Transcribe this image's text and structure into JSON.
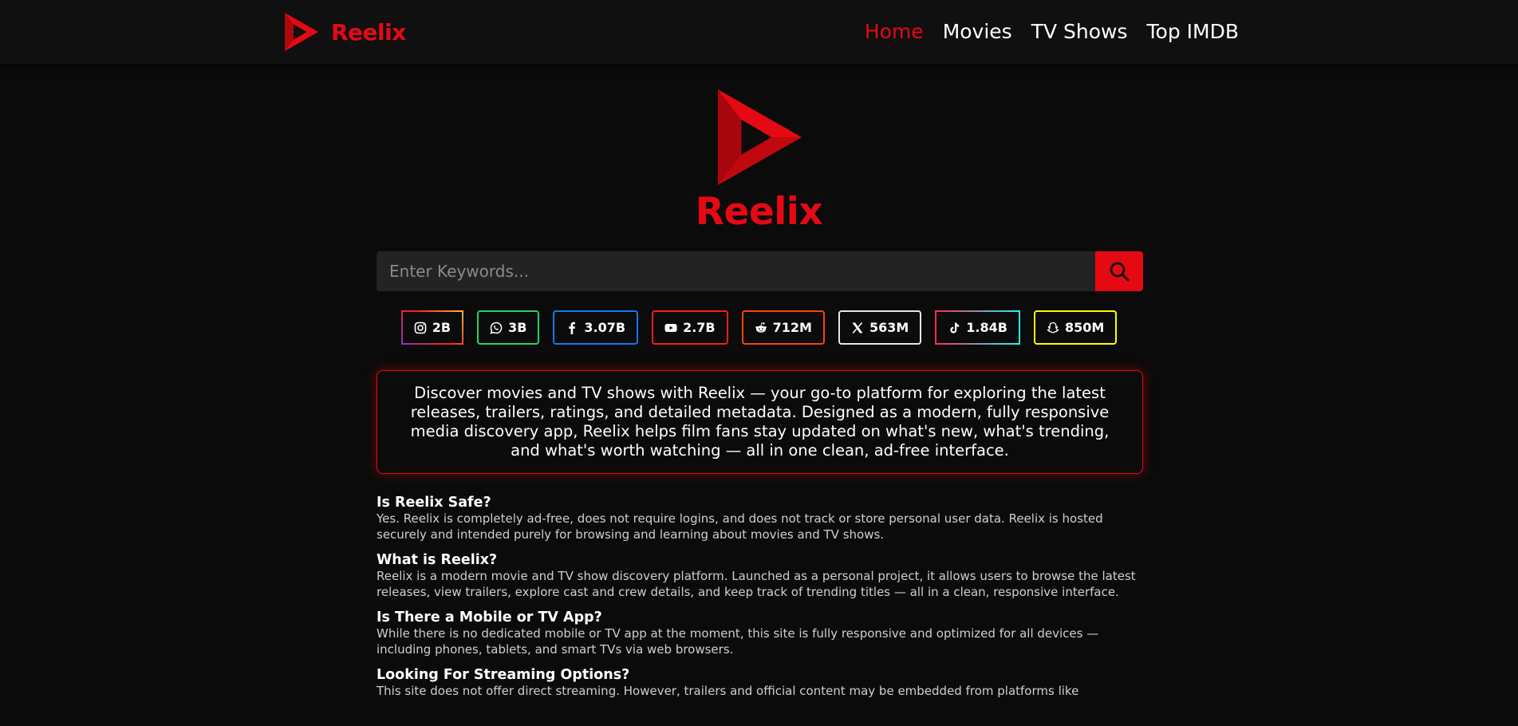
{
  "colors": {
    "accent": "#e50914",
    "background": "#0b0b0b",
    "search_bg": "#232323"
  },
  "header": {
    "brand": "Reelix",
    "logo_icon": "play-logo-icon",
    "nav": [
      {
        "label": "Home",
        "active": true
      },
      {
        "label": "Movies",
        "active": false
      },
      {
        "label": "TV Shows",
        "active": false
      },
      {
        "label": "Top IMDB",
        "active": false
      }
    ]
  },
  "hero": {
    "title": "Reelix",
    "logo_icon": "play-logo-icon"
  },
  "search": {
    "placeholder": "Enter Keywords...",
    "value": "",
    "button_icon": "search-icon"
  },
  "socials": [
    {
      "icon": "instagram-icon",
      "count": "2B",
      "color": "#c13584"
    },
    {
      "icon": "whatsapp-icon",
      "count": "3B",
      "color": "#25d366"
    },
    {
      "icon": "facebook-icon",
      "count": "3.07B",
      "color": "#1877f2"
    },
    {
      "icon": "youtube-icon",
      "count": "2.7B",
      "color": "#ff0000"
    },
    {
      "icon": "reddit-icon",
      "count": "712M",
      "color": "#ff4500"
    },
    {
      "icon": "x-icon",
      "count": "563M",
      "color": "#e6e6e6"
    },
    {
      "icon": "tiktok-icon",
      "count": "1.84B",
      "color": "#fe2c55"
    },
    {
      "icon": "snapchat-icon",
      "count": "850M",
      "color": "#fffc00"
    }
  ],
  "intro": {
    "text": "Discover movies and TV shows with Reelix — your go-to platform for exploring the latest releases, trailers, ratings, and detailed metadata. Designed as a modern, fully responsive media discovery app, Reelix helps film fans stay updated on what's new, what's trending, and what's worth watching — all in one clean, ad-free interface."
  },
  "faq": [
    {
      "question": "Is Reelix Safe?",
      "answer": "Yes. Reelix is completely ad-free, does not require logins, and does not track or store personal user data. Reelix is hosted securely and intended purely for browsing and learning about movies and TV shows."
    },
    {
      "question": "What is Reelix?",
      "answer": "Reelix is a modern movie and TV show discovery platform. Launched as a personal project, it allows users to browse the latest releases, view trailers, explore cast and crew details, and keep track of trending titles — all in a clean, responsive interface."
    },
    {
      "question": "Is There a Mobile or TV App?",
      "answer": "While there is no dedicated mobile or TV app at the moment, this site is fully responsive and optimized for all devices — including phones, tablets, and smart TVs via web browsers."
    },
    {
      "question": "Looking For Streaming Options?",
      "answer": "This site does not offer direct streaming. However, trailers and official content may be embedded from platforms like"
    }
  ]
}
